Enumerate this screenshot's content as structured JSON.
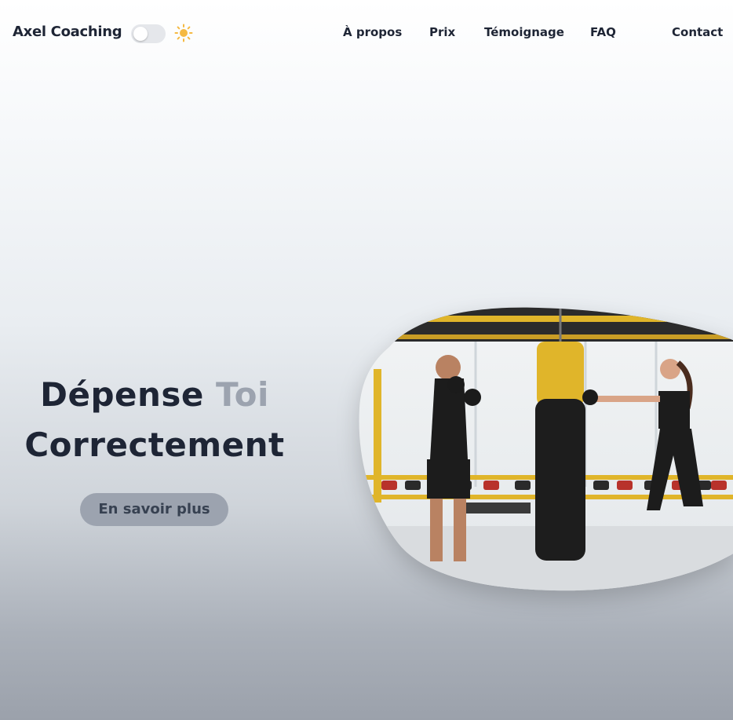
{
  "header": {
    "brand": "Axel Coaching",
    "theme_toggle": {
      "state": "off",
      "icon": "sun-icon",
      "icon_color": "#f5b942"
    },
    "nav": [
      {
        "label": "À propos"
      },
      {
        "label": "Prix"
      },
      {
        "label": "Témoignage"
      },
      {
        "label": "FAQ"
      },
      {
        "label": "Contact"
      }
    ]
  },
  "hero": {
    "title_word1": "Dépense",
    "title_word2": "Toi",
    "title_word3": "Correctement",
    "cta_label": "En savoir plus",
    "image": {
      "subject": "boxing-gym-photo",
      "icon": "boxing-training-image"
    }
  },
  "colors": {
    "text_dark": "#1e2535",
    "text_muted": "#9ca3af",
    "button_bg": "#9ca3af",
    "button_text": "#374151"
  }
}
